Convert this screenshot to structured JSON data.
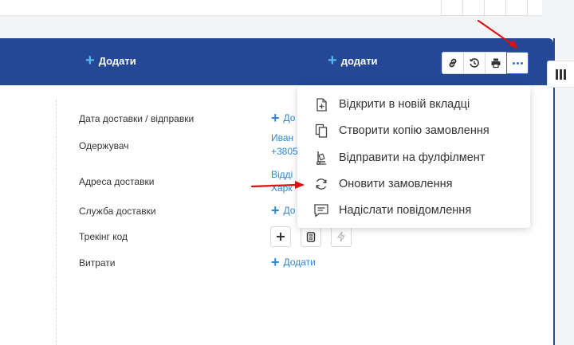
{
  "header": {
    "add_left": "Додати",
    "add_right": "додати"
  },
  "toolbar": {
    "link_icon": "link-icon",
    "history_icon": "history-icon",
    "print_icon": "print-icon",
    "more_icon": "more-dots-icon"
  },
  "fields": [
    {
      "label": "Дата доставки / відправки",
      "value": "До"
    },
    {
      "label": "Одержувач",
      "value_line1": "Иван",
      "value_line2": "+3805"
    },
    {
      "label": "Адреса доставки",
      "value_line1": "Відді",
      "value_line2": "Харк"
    },
    {
      "label": "Служба доставки",
      "value": "До"
    },
    {
      "label": "Трекінг код"
    },
    {
      "label": "Витрати",
      "value": "Додати"
    }
  ],
  "menu": {
    "items": [
      {
        "label": "Відкрити в новій вкладці",
        "icon": "open-new-tab-icon"
      },
      {
        "label": "Створити копію замовлення",
        "icon": "copy-icon"
      },
      {
        "label": "Відправити на фулфілмент",
        "icon": "fulfillment-icon"
      },
      {
        "label": "Оновити замовлення",
        "icon": "refresh-icon"
      },
      {
        "label": "Надіслати повідомлення",
        "icon": "message-icon"
      }
    ]
  },
  "colors": {
    "header_bg": "#254896",
    "accent": "#2f86d6",
    "annotation_arrow": "#e01010"
  }
}
